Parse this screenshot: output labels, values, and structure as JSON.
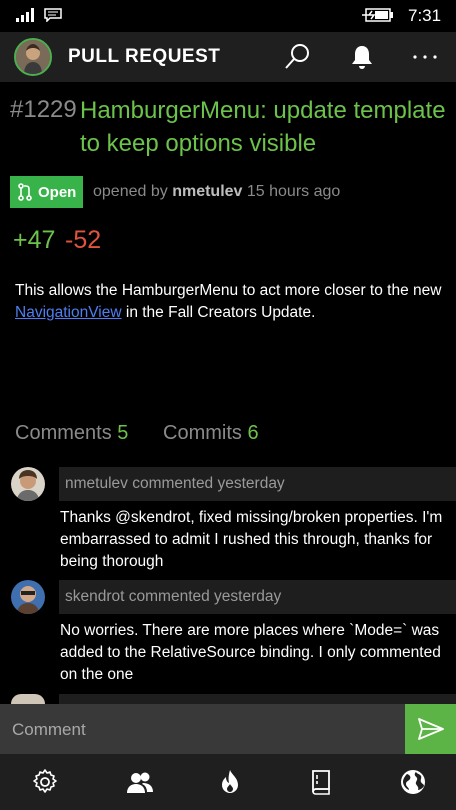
{
  "status": {
    "time": "7:31"
  },
  "appbar": {
    "title": "PULL REQUEST"
  },
  "pr": {
    "number": "#1229",
    "title": "HamburgerMenu: update template to keep options visible",
    "state": "Open",
    "opened_by_prefix": "opened by",
    "author": "nmetulev",
    "time_ago": "15 hours ago",
    "additions": "+47",
    "deletions": "-52",
    "description_pre": "This allows the HamburgerMenu to act more closer to the new",
    "description_link": "NavigationView",
    "description_post": "in the Fall Creators Update."
  },
  "tabs": [
    {
      "label": "Comments",
      "count": "5"
    },
    {
      "label": "Commits",
      "count": "6"
    }
  ],
  "comments": [
    {
      "header": "nmetulev commented yesterday",
      "body": "Thanks @skendrot, fixed missing/broken properties. I'm embarrassed to admit I rushed this through, thanks for being thorough"
    },
    {
      "header": "skendrot commented yesterday",
      "body": "No worries. There are more places where `Mode=` was added to the RelativeSource binding. I only commented on the one"
    }
  ],
  "comment_input": {
    "placeholder": "Comment"
  },
  "bottom_nav": [
    "settings-icon",
    "people-icon",
    "trending-icon",
    "repository-icon",
    "explore-icon"
  ],
  "colors": {
    "accent_green": "#6cc24a",
    "open_badge": "#38b349",
    "deletion_red": "#e0533f",
    "link_blue": "#4f7ef2"
  }
}
